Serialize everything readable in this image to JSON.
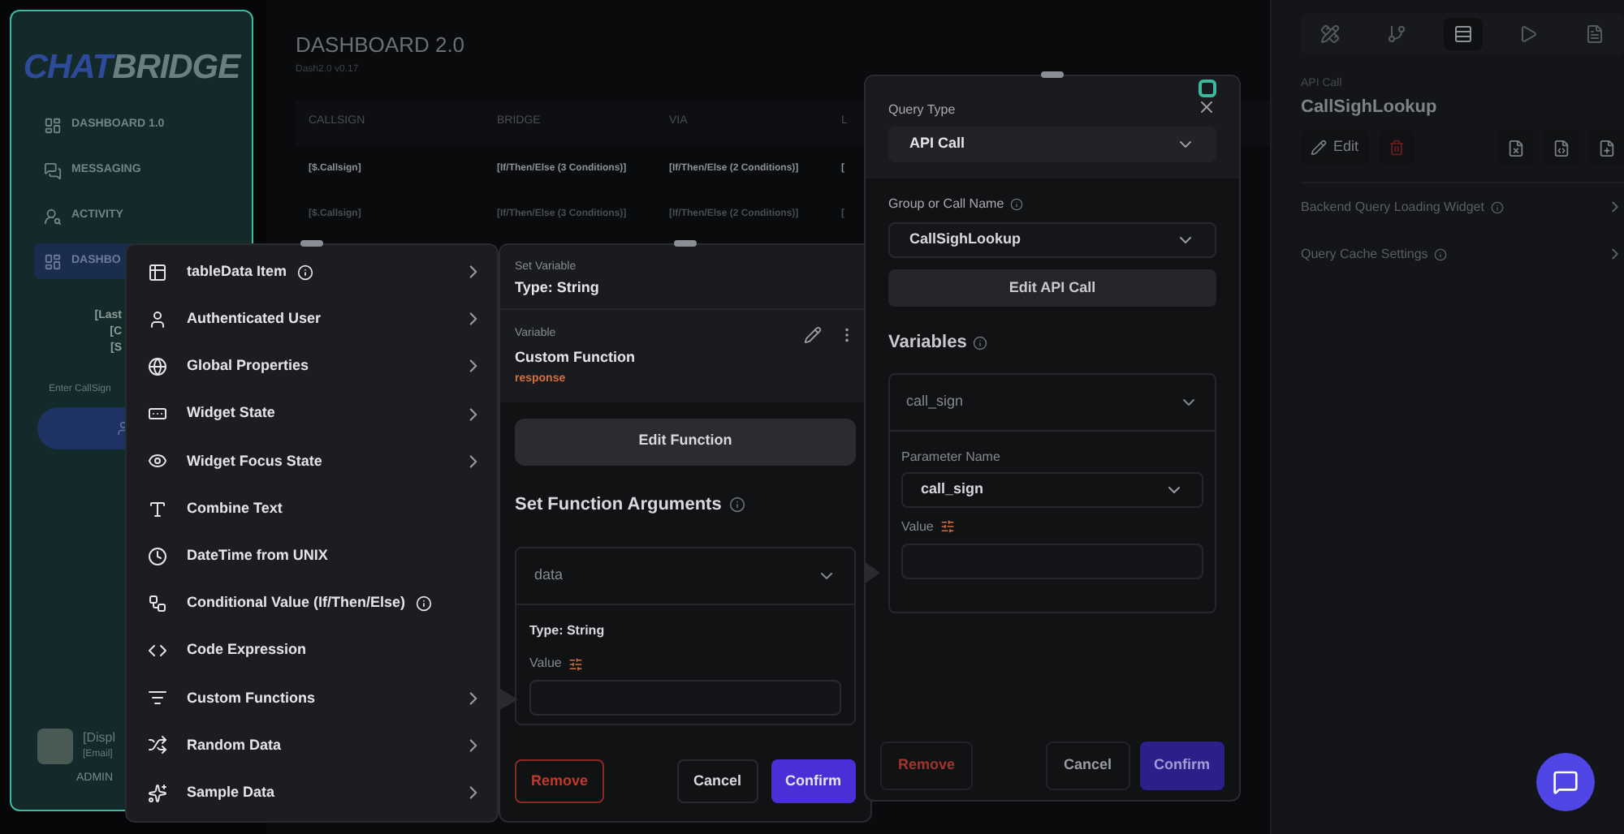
{
  "sidebar": {
    "logo": {
      "left": "CHAT",
      "right": "BRIDGE"
    },
    "nav": [
      {
        "label": "DASHBOARD 1.0",
        "selected": false
      },
      {
        "label": "MESSAGING",
        "selected": false
      },
      {
        "label": "ACTIVITY",
        "selected": false
      },
      {
        "label": "DASHBO",
        "selected": true
      }
    ],
    "card_lines": [
      "[Last",
      "[C",
      "[S"
    ],
    "callsign_placeholder": "Enter CallSign",
    "user": {
      "name": "[Displ",
      "email": "[Email]",
      "role": "ADMIN"
    }
  },
  "main": {
    "title": "DASHBOARD 2.0",
    "subtitle": "Dash2.0 v0.17",
    "table": {
      "columns": [
        "CALLSIGN",
        "BRIDGE",
        "VIA",
        "L"
      ],
      "rows": [
        {
          "muted": false,
          "cells": [
            "[$.Callsign]",
            "[If/Then/Else (3 Conditions)]",
            "[If/Then/Else (2 Conditions)]",
            "["
          ]
        },
        {
          "muted": true,
          "cells": [
            "[$.Callsign]",
            "[If/Then/Else (3 Conditions)]",
            "[If/Then/Else (2 Conditions)]",
            "["
          ]
        }
      ]
    }
  },
  "right_panel": {
    "tools": [
      {
        "selected": false
      },
      {
        "selected": false
      },
      {
        "selected": true
      },
      {
        "selected": false
      },
      {
        "selected": false
      }
    ],
    "kind_label": "API Call",
    "name": "CallSighLookup",
    "edit_label": "Edit",
    "sections": [
      {
        "label": "Backend Query Loading Widget"
      },
      {
        "label": "Query Cache Settings"
      }
    ]
  },
  "menu": {
    "items": [
      {
        "label": "tableData Item",
        "info": true,
        "submenu": true
      },
      {
        "label": "Authenticated User",
        "info": false,
        "submenu": true
      },
      {
        "label": "Global Properties",
        "info": false,
        "submenu": true
      },
      {
        "label": "Widget State",
        "info": false,
        "submenu": true
      },
      {
        "label": "Widget Focus State",
        "info": false,
        "submenu": true
      },
      {
        "label": "Combine Text",
        "info": false,
        "submenu": false
      },
      {
        "label": "DateTime from UNIX",
        "info": false,
        "submenu": false
      },
      {
        "label": "Conditional Value (If/Then/Else)",
        "info": true,
        "submenu": false
      },
      {
        "label": "Code Expression",
        "info": false,
        "submenu": false
      },
      {
        "label": "Custom Functions",
        "info": false,
        "submenu": true
      },
      {
        "label": "Random Data",
        "info": false,
        "submenu": true
      },
      {
        "label": "Sample Data",
        "info": false,
        "submenu": true
      }
    ]
  },
  "variable_panel": {
    "header_label": "Set Variable",
    "header_type": "Type: String",
    "variable_label": "Variable",
    "variable_name": "Custom Function",
    "variable_source": "response",
    "edit_function": "Edit Function",
    "arguments_title": "Set Function Arguments",
    "argument": {
      "name": "data",
      "type": "Type: String",
      "value_label": "Value"
    },
    "remove": "Remove",
    "cancel": "Cancel",
    "confirm": "Confirm"
  },
  "query_panel": {
    "query_type_label": "Query Type",
    "query_type": "API Call",
    "call_name_label": "Group or Call Name",
    "call_name": "CallSighLookup",
    "edit_call": "Edit API Call",
    "variables_title": "Variables",
    "variable": "call_sign",
    "parameter_label": "Parameter Name",
    "parameter": "call_sign",
    "value_label": "Value",
    "remove": "Remove",
    "cancel": "Cancel",
    "confirm": "Confirm"
  }
}
